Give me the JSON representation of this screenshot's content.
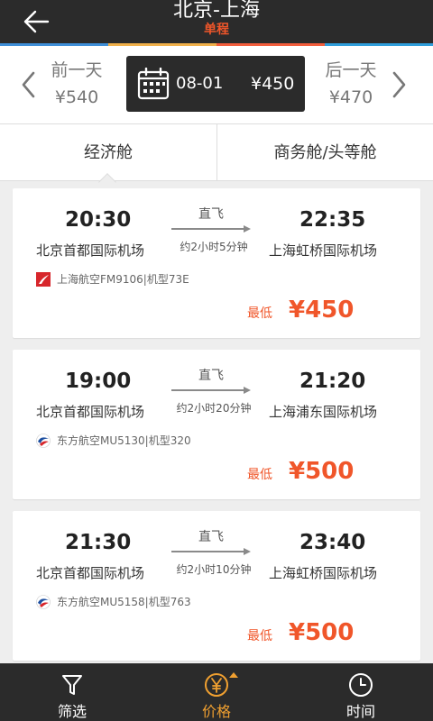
{
  "header": {
    "title": "北京-上海",
    "subtitle": "单程"
  },
  "datebar": {
    "prev": {
      "label": "前一天",
      "price": "¥540"
    },
    "selected": {
      "date": "08-01",
      "price": "¥450"
    },
    "next": {
      "label": "后一天",
      "price": "¥470"
    }
  },
  "tabs": [
    {
      "label": "经济舱"
    },
    {
      "label": "商务舱/头等舱"
    }
  ],
  "flights": [
    {
      "dep_time": "20:30",
      "arr_time": "22:35",
      "dep_airport": "北京首都国际机场",
      "arr_airport": "上海虹桥国际机场",
      "direct": "直飞",
      "duration": "约2小时5分钟",
      "airline": "上海航空FM9106|机型73E",
      "price_label": "最低",
      "price": "¥450"
    },
    {
      "dep_time": "19:00",
      "arr_time": "21:20",
      "dep_airport": "北京首都国际机场",
      "arr_airport": "上海浦东国际机场",
      "direct": "直飞",
      "duration": "约2小时20分钟",
      "airline": "东方航空MU5130|机型320",
      "price_label": "最低",
      "price": "¥500"
    },
    {
      "dep_time": "21:30",
      "arr_time": "23:40",
      "dep_airport": "北京首都国际机场",
      "arr_airport": "上海虹桥国际机场",
      "direct": "直飞",
      "duration": "约2小时10分钟",
      "airline": "东方航空MU5158|机型763",
      "price_label": "最低",
      "price": "¥500"
    }
  ],
  "bottom_nav": [
    {
      "label": "筛选",
      "icon": "filter-icon"
    },
    {
      "label": "价格",
      "icon": "yen-icon"
    },
    {
      "label": "时间",
      "icon": "clock-icon"
    }
  ],
  "colors": {
    "header_bg": "#2b2b2b",
    "accent": "#f0562a",
    "active_nav": "#f0a030",
    "background": "#eeeeee"
  }
}
